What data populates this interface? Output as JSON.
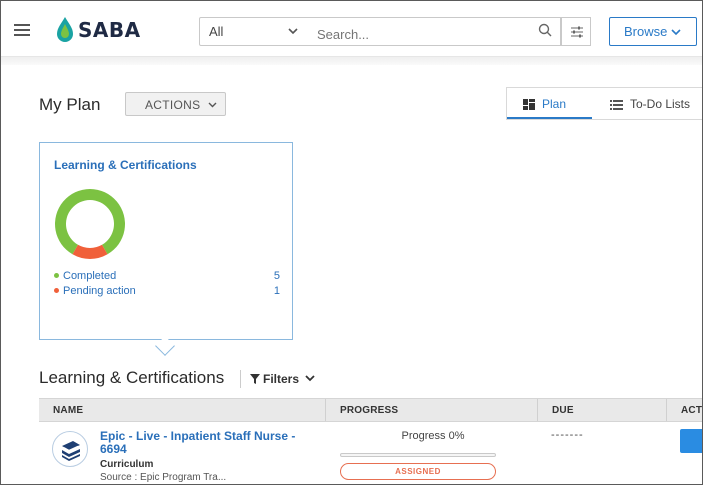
{
  "header": {
    "logo_text": "SABA",
    "scope_value": "All",
    "search_placeholder": "Search...",
    "browse_label": "Browse"
  },
  "plan": {
    "title": "My Plan",
    "actions_label": "ACTIONS",
    "tabs": [
      {
        "label": "Plan",
        "active": true
      },
      {
        "label": "To-Do Lists",
        "active": false
      }
    ]
  },
  "summary_card": {
    "title": "Learning & Certifications",
    "legend": [
      {
        "label": "Completed",
        "count": "5",
        "color": "#7cc242"
      },
      {
        "label": "Pending action",
        "count": "1",
        "color": "#f0603a"
      }
    ]
  },
  "chart_data": {
    "type": "pie",
    "categories": [
      "Completed",
      "Pending action"
    ],
    "values": [
      5,
      1
    ]
  },
  "section": {
    "title": "Learning & Certifications",
    "filters_label": "Filters"
  },
  "table": {
    "columns": [
      "NAME",
      "PROGRESS",
      "DUE",
      "ACTI"
    ],
    "rows": [
      {
        "title": "Epic - Live - Inpatient Staff Nurse - 6694",
        "type": "Curriculum",
        "source": "Source : Epic Program Tra...",
        "progress_text": "Progress 0%",
        "progress_fraction": 0,
        "status": "ASSIGNED",
        "due": "-------"
      }
    ]
  },
  "colors": {
    "accent": "#2a7ac7",
    "completed": "#7cc242",
    "pending": "#f0603a",
    "status_assigned": "#e76f51"
  }
}
